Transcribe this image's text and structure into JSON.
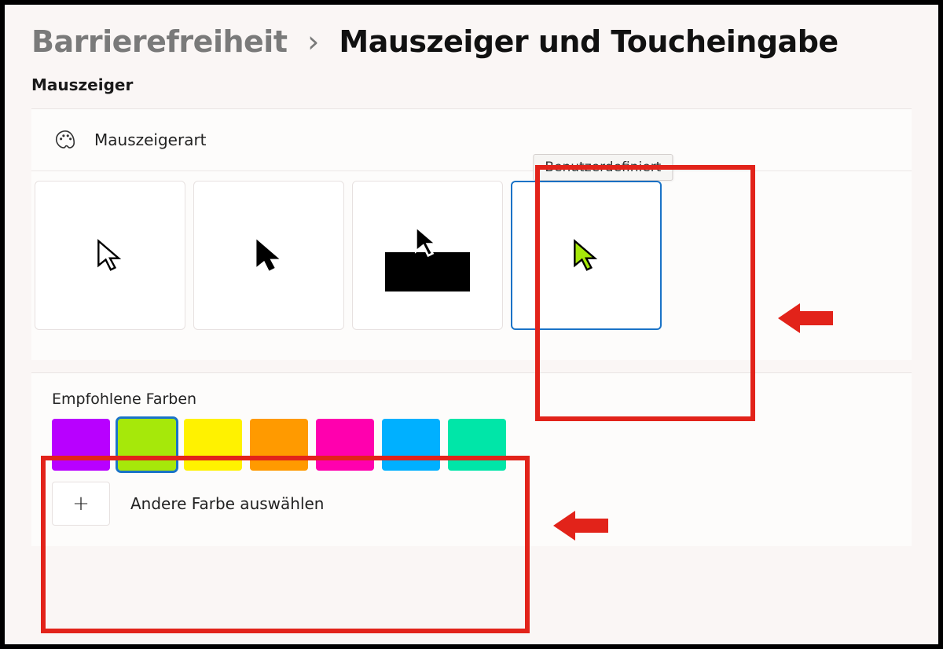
{
  "breadcrumb": {
    "parent": "Barrierefreiheit",
    "current": "Mauszeiger und Toucheingabe"
  },
  "section_heading": "Mauszeiger",
  "pointer_style": {
    "title": "Mauszeigerart",
    "tooltip_custom": "Benutzerdefiniert",
    "custom_color": "#a6e80a",
    "selected_index": 3
  },
  "recommended_colors": {
    "label": "Empfohlene Farben",
    "swatches": [
      "#b800ff",
      "#a6e80a",
      "#fff200",
      "#ff9a00",
      "#ff00ae",
      "#00b0ff",
      "#00e6a8"
    ],
    "selected_index": 1
  },
  "pick_more": {
    "label": "Andere Farbe auswählen"
  },
  "annotation": {
    "highlight_color": "#e2231a"
  }
}
